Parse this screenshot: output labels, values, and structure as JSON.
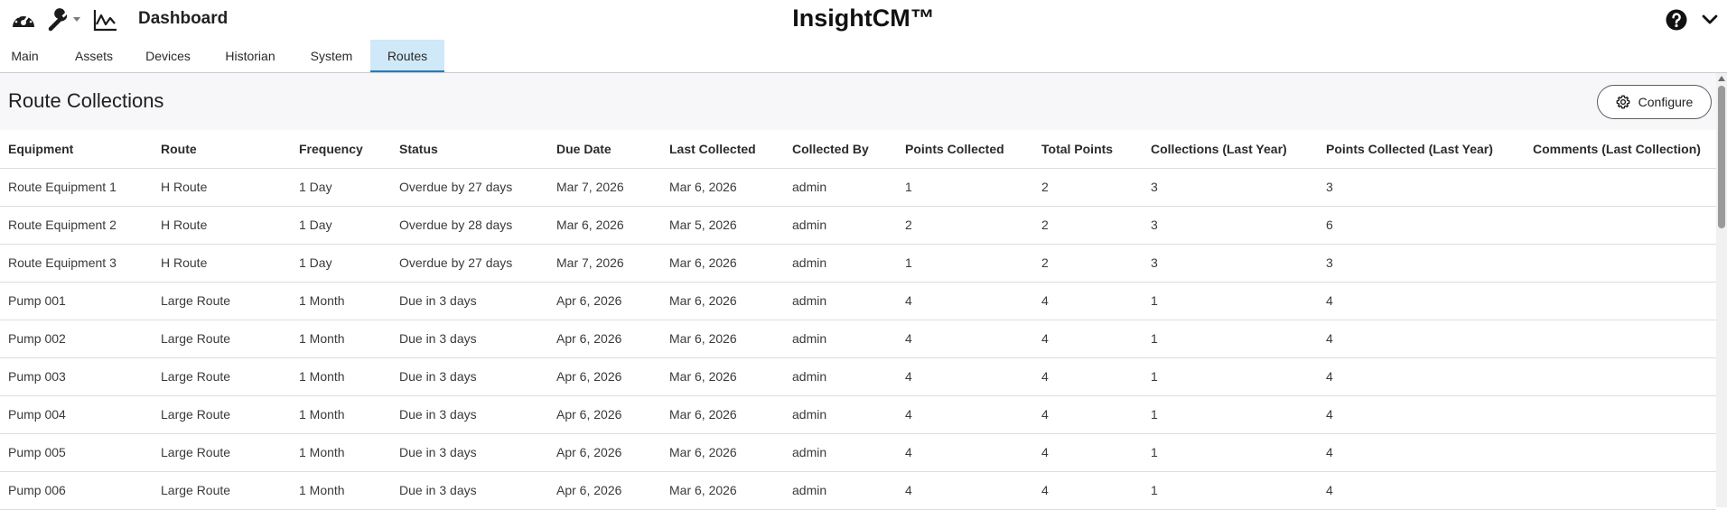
{
  "header": {
    "dashboard_label": "Dashboard",
    "app_title": "InsightCM™",
    "icons": [
      "speedometer-icon",
      "wrench-icon",
      "caret-down-icon",
      "trend-chart-icon",
      "help-icon",
      "chevron-down-icon"
    ]
  },
  "tabs": [
    {
      "label": "Main"
    },
    {
      "label": "Assets"
    },
    {
      "label": "Devices"
    },
    {
      "label": "Historian"
    },
    {
      "label": "System"
    },
    {
      "label": "Routes",
      "active": true
    }
  ],
  "section": {
    "title": "Route Collections",
    "configure_label": "Configure"
  },
  "table": {
    "columns": [
      "Equipment",
      "Route",
      "Frequency",
      "Status",
      "Due Date",
      "Last Collected",
      "Collected By",
      "Points Collected",
      "Total Points",
      "Collections (Last Year)",
      "Points Collected (Last Year)",
      "Comments (Last Collection)"
    ],
    "rows": [
      [
        "Route Equipment 1",
        "H Route",
        "1 Day",
        "Overdue by 27 days",
        "Mar 7, 2026",
        "Mar 6, 2026",
        "admin",
        "1",
        "2",
        "3",
        "3",
        ""
      ],
      [
        "Route Equipment 2",
        "H Route",
        "1 Day",
        "Overdue by 28 days",
        "Mar 6, 2026",
        "Mar 5, 2026",
        "admin",
        "2",
        "2",
        "3",
        "6",
        ""
      ],
      [
        "Route Equipment 3",
        "H Route",
        "1 Day",
        "Overdue by 27 days",
        "Mar 7, 2026",
        "Mar 6, 2026",
        "admin",
        "1",
        "2",
        "3",
        "3",
        ""
      ],
      [
        "Pump 001",
        "Large Route",
        "1 Month",
        "Due in 3 days",
        "Apr 6, 2026",
        "Mar 6, 2026",
        "admin",
        "4",
        "4",
        "1",
        "4",
        ""
      ],
      [
        "Pump 002",
        "Large Route",
        "1 Month",
        "Due in 3 days",
        "Apr 6, 2026",
        "Mar 6, 2026",
        "admin",
        "4",
        "4",
        "1",
        "4",
        ""
      ],
      [
        "Pump 003",
        "Large Route",
        "1 Month",
        "Due in 3 days",
        "Apr 6, 2026",
        "Mar 6, 2026",
        "admin",
        "4",
        "4",
        "1",
        "4",
        ""
      ],
      [
        "Pump 004",
        "Large Route",
        "1 Month",
        "Due in 3 days",
        "Apr 6, 2026",
        "Mar 6, 2026",
        "admin",
        "4",
        "4",
        "1",
        "4",
        ""
      ],
      [
        "Pump 005",
        "Large Route",
        "1 Month",
        "Due in 3 days",
        "Apr 6, 2026",
        "Mar 6, 2026",
        "admin",
        "4",
        "4",
        "1",
        "4",
        ""
      ],
      [
        "Pump 006",
        "Large Route",
        "1 Month",
        "Due in 3 days",
        "Apr 6, 2026",
        "Mar 6, 2026",
        "admin",
        "4",
        "4",
        "1",
        "4",
        ""
      ]
    ]
  }
}
